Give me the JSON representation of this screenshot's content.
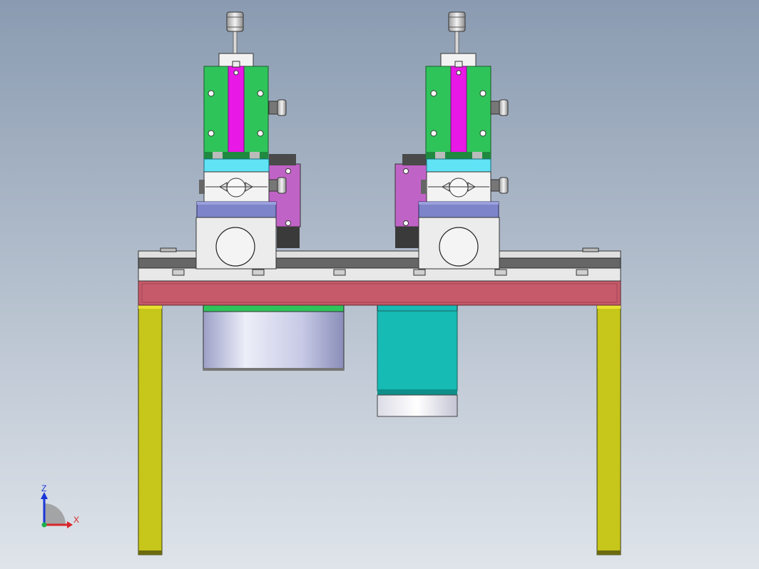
{
  "viewport": {
    "background_top": "#8a9bb1",
    "background_bottom": "#dfe4ea"
  },
  "colors": {
    "slide_body": "#2fc45a",
    "slide_strip": "#e818e6",
    "cyan_block": "#5fe3f5",
    "base_plate": "#7d84c9",
    "bracket": "#c063c6",
    "bearing_block": "#ececec",
    "rail": "#d9d9d9",
    "rail_dark": "#555555",
    "red_plate": "#c65a6a",
    "leg": "#c7c61a",
    "drum": "#c5c7e6",
    "motor": "#16bbb4",
    "motor_cap": "#f0f0f0"
  },
  "parts": {
    "stages": [
      "left-xyz-stage",
      "right-xyz-stage"
    ],
    "motors": [
      "drum-motor",
      "cyan-servo-motor"
    ]
  },
  "triad": {
    "z_label": "Z",
    "x_label": "X",
    "z_color": "#1a36d8",
    "x_color": "#d8252a",
    "y_color": "#1cb04a",
    "arc_color": "#9a9a9a"
  }
}
